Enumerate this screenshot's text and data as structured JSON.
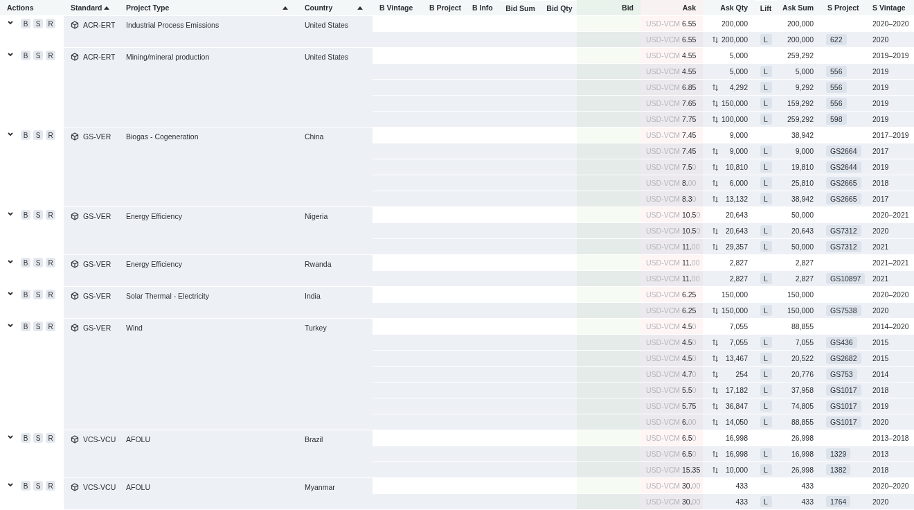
{
  "columns": [
    {
      "label": "Actions",
      "sorted_ascending": false
    },
    {
      "label": "Standard",
      "sorted_ascending": true
    },
    {
      "label": "Project Type",
      "sorted_ascending": true
    },
    {
      "label": "Country",
      "sorted_ascending": true
    },
    {
      "label": "B Vintage",
      "sorted_ascending": false
    },
    {
      "label": "B Project",
      "sorted_ascending": false
    },
    {
      "label": "B Info",
      "sorted_ascending": false
    },
    {
      "label": "Bid Sum",
      "sorted_ascending": false
    },
    {
      "label": "Bid Qty",
      "sorted_ascending": false
    },
    {
      "label": "Bid",
      "sorted_ascending": false
    },
    {
      "label": "Ask",
      "sorted_ascending": false
    },
    {
      "label": "Ask Qty",
      "sorted_ascending": false
    },
    {
      "label": "Lift",
      "sorted_ascending": false
    },
    {
      "label": "Ask Sum",
      "sorted_ascending": false
    },
    {
      "label": "S Project",
      "sorted_ascending": false
    },
    {
      "label": "S Vintage",
      "sorted_ascending": false
    }
  ],
  "groups": [
    {
      "expanded": true,
      "actions": [
        "B",
        "S",
        "R"
      ],
      "standard": "ACR-ERT",
      "project_type": "Industrial Process Emissions",
      "country": "United States",
      "summary": {
        "currency": "USD-VCM",
        "price": "6.55",
        "ask_qty": "200,000",
        "ask_sum": "200,000",
        "vintage": "2020–2020"
      },
      "children": [
        {
          "currency": "USD-VCM",
          "price": "6.55",
          "swap": true,
          "ask_qty": "200,000",
          "lift": "L",
          "ask_sum": "200,000",
          "project": "622",
          "vintage": "2020"
        }
      ]
    },
    {
      "expanded": true,
      "actions": [
        "B",
        "S",
        "R"
      ],
      "standard": "ACR-ERT",
      "project_type": "Mining/mineral production",
      "country": "United States",
      "summary": {
        "currency": "USD-VCM",
        "price": "4.55",
        "ask_qty": "5,000",
        "ask_sum": "259,292",
        "vintage": "2019–2019"
      },
      "children": [
        {
          "currency": "USD-VCM",
          "price": "4.55",
          "swap": false,
          "ask_qty": "5,000",
          "lift": "L",
          "ask_sum": "5,000",
          "project": "556",
          "vintage": "2019"
        },
        {
          "currency": "USD-VCM",
          "price": "6.85",
          "swap": true,
          "ask_qty": "4,292",
          "lift": "L",
          "ask_sum": "9,292",
          "project": "556",
          "vintage": "2019"
        },
        {
          "currency": "USD-VCM",
          "price": "7.65",
          "swap": true,
          "ask_qty": "150,000",
          "lift": "L",
          "ask_sum": "159,292",
          "project": "556",
          "vintage": "2019"
        },
        {
          "currency": "USD-VCM",
          "price": "7.75",
          "swap": true,
          "ask_qty": "100,000",
          "lift": "L",
          "ask_sum": "259,292",
          "project": "598",
          "vintage": "2019"
        }
      ]
    },
    {
      "expanded": true,
      "actions": [
        "B",
        "S",
        "R"
      ],
      "standard": "GS-VER",
      "project_type": "Biogas - Cogeneration",
      "country": "China",
      "summary": {
        "currency": "USD-VCM",
        "price": "7.45",
        "ask_qty": "9,000",
        "ask_sum": "38,942",
        "vintage": "2017–2019"
      },
      "children": [
        {
          "currency": "USD-VCM",
          "price": "7.45",
          "swap": true,
          "ask_qty": "9,000",
          "lift": "L",
          "ask_sum": "9,000",
          "project": "GS2664",
          "vintage": "2017"
        },
        {
          "currency": "USD-VCM",
          "price": "7.5",
          "price_trailing": "0",
          "swap": true,
          "ask_qty": "10,810",
          "lift": "L",
          "ask_sum": "19,810",
          "project": "GS2644",
          "vintage": "2019"
        },
        {
          "currency": "USD-VCM",
          "price": "8.",
          "price_trailing": "00",
          "swap": true,
          "ask_qty": "6,000",
          "lift": "L",
          "ask_sum": "25,810",
          "project": "GS2665",
          "vintage": "2018"
        },
        {
          "currency": "USD-VCM",
          "price": "8.3",
          "price_trailing": "0",
          "swap": true,
          "ask_qty": "13,132",
          "lift": "L",
          "ask_sum": "38,942",
          "project": "GS2665",
          "vintage": "2017"
        }
      ]
    },
    {
      "expanded": true,
      "actions": [
        "B",
        "S",
        "R"
      ],
      "standard": "GS-VER",
      "project_type": "Energy Efficiency",
      "country": "Nigeria",
      "summary": {
        "currency": "USD-VCM",
        "price": "10.5",
        "price_trailing": "0",
        "ask_qty": "20,643",
        "ask_sum": "50,000",
        "vintage": "2020–2021"
      },
      "children": [
        {
          "currency": "USD-VCM",
          "price": "10.5",
          "price_trailing": "0",
          "swap": true,
          "ask_qty": "20,643",
          "lift": "L",
          "ask_sum": "20,643",
          "project": "GS7312",
          "vintage": "2020"
        },
        {
          "currency": "USD-VCM",
          "price": "11.",
          "price_trailing": "00",
          "swap": true,
          "ask_qty": "29,357",
          "lift": "L",
          "ask_sum": "50,000",
          "project": "GS7312",
          "vintage": "2021"
        }
      ]
    },
    {
      "expanded": true,
      "actions": [
        "B",
        "S",
        "R"
      ],
      "standard": "GS-VER",
      "project_type": "Energy Efficiency",
      "country": "Rwanda",
      "summary": {
        "currency": "USD-VCM",
        "price": "11.",
        "price_trailing": "00",
        "ask_qty": "2,827",
        "ask_sum": "2,827",
        "vintage": "2021–2021"
      },
      "children": [
        {
          "currency": "USD-VCM",
          "price": "11.",
          "price_trailing": "00",
          "swap": false,
          "ask_qty": "2,827",
          "lift": "L",
          "ask_sum": "2,827",
          "project": "GS10897",
          "vintage": "2021"
        }
      ]
    },
    {
      "expanded": true,
      "actions": [
        "B",
        "S",
        "R"
      ],
      "standard": "GS-VER",
      "project_type": "Solar Thermal - Electricity",
      "country": "India",
      "summary": {
        "currency": "USD-VCM",
        "price": "6.25",
        "ask_qty": "150,000",
        "ask_sum": "150,000",
        "vintage": "2020–2020"
      },
      "children": [
        {
          "currency": "USD-VCM",
          "price": "6.25",
          "swap": true,
          "ask_qty": "150,000",
          "lift": "L",
          "ask_sum": "150,000",
          "project": "GS7538",
          "vintage": "2020"
        }
      ]
    },
    {
      "expanded": true,
      "actions": [
        "B",
        "S",
        "R"
      ],
      "standard": "GS-VER",
      "project_type": "Wind",
      "country": "Turkey",
      "summary": {
        "currency": "USD-VCM",
        "price": "4.5",
        "price_trailing": "0",
        "ask_qty": "7,055",
        "ask_sum": "88,855",
        "vintage": "2014–2020"
      },
      "children": [
        {
          "currency": "USD-VCM",
          "price": "4.5",
          "price_trailing": "0",
          "swap": true,
          "ask_qty": "7,055",
          "lift": "L",
          "ask_sum": "7,055",
          "project": "GS436",
          "vintage": "2015"
        },
        {
          "currency": "USD-VCM",
          "price": "4.5",
          "price_trailing": "0",
          "swap": true,
          "ask_qty": "13,467",
          "lift": "L",
          "ask_sum": "20,522",
          "project": "GS2682",
          "vintage": "2015"
        },
        {
          "currency": "USD-VCM",
          "price": "4.7",
          "price_trailing": "0",
          "swap": true,
          "ask_qty": "254",
          "lift": "L",
          "ask_sum": "20,776",
          "project": "GS753",
          "vintage": "2014"
        },
        {
          "currency": "USD-VCM",
          "price": "5.5",
          "price_trailing": "0",
          "swap": true,
          "ask_qty": "17,182",
          "lift": "L",
          "ask_sum": "37,958",
          "project": "GS1017",
          "vintage": "2018"
        },
        {
          "currency": "USD-VCM",
          "price": "5.75",
          "swap": true,
          "ask_qty": "36,847",
          "lift": "L",
          "ask_sum": "74,805",
          "project": "GS1017",
          "vintage": "2019"
        },
        {
          "currency": "USD-VCM",
          "price": "6.",
          "price_trailing": "00",
          "swap": true,
          "ask_qty": "14,050",
          "lift": "L",
          "ask_sum": "88,855",
          "project": "GS1017",
          "vintage": "2020"
        }
      ]
    },
    {
      "expanded": true,
      "actions": [
        "B",
        "S",
        "R"
      ],
      "standard": "VCS-VCU",
      "project_type": "AFOLU",
      "country": "Brazil",
      "summary": {
        "currency": "USD-VCM",
        "price": "6.5",
        "price_trailing": "0",
        "ask_qty": "16,998",
        "ask_sum": "26,998",
        "vintage": "2013–2018"
      },
      "children": [
        {
          "currency": "USD-VCM",
          "price": "6.5",
          "price_trailing": "0",
          "swap": true,
          "ask_qty": "16,998",
          "lift": "L",
          "ask_sum": "16,998",
          "project": "1329",
          "vintage": "2013"
        },
        {
          "currency": "USD-VCM",
          "price": "15.35",
          "swap": true,
          "ask_qty": "10,000",
          "lift": "L",
          "ask_sum": "26,998",
          "project": "1382",
          "vintage": "2018"
        }
      ]
    },
    {
      "expanded": true,
      "actions": [
        "B",
        "S",
        "R"
      ],
      "standard": "VCS-VCU",
      "project_type": "AFOLU",
      "country": "Myanmar",
      "summary": {
        "currency": "USD-VCM",
        "price": "30.",
        "price_trailing": "00",
        "ask_qty": "433",
        "ask_sum": "433",
        "vintage": "2020–2020"
      },
      "children": [
        {
          "currency": "USD-VCM",
          "price": "30.",
          "price_trailing": "00",
          "swap": false,
          "ask_qty": "433",
          "lift": "L",
          "ask_sum": "433",
          "project": "1764",
          "vintage": "2020"
        }
      ]
    }
  ]
}
